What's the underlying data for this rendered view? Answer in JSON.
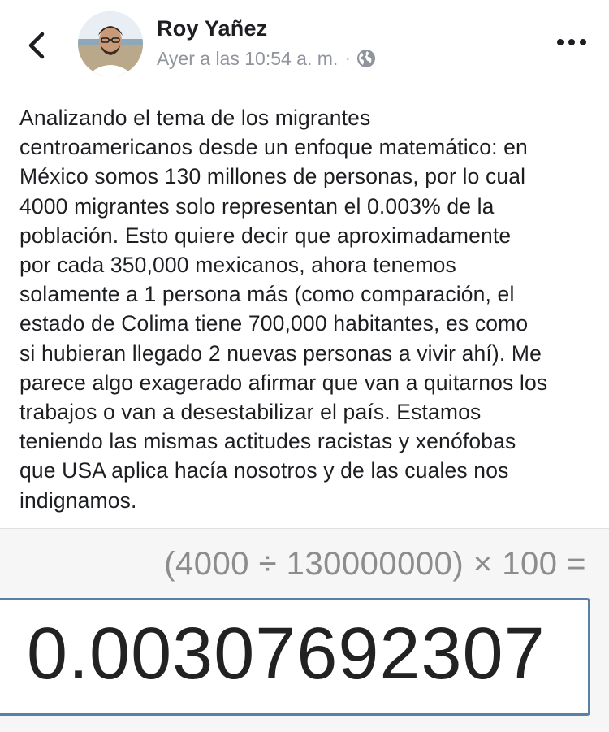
{
  "post": {
    "author_name": "Roy Yañez",
    "timestamp": "Ayer a las 10:54 a. m.",
    "separator": "·",
    "visibility_icon": "globe-icon",
    "text": "Analizando el tema de los migrantes\ncentroamericanos desde un enfoque matemático: en\nMéxico somos 130 millones de personas, por lo cual\n4000 migrantes solo representan el 0.003% de la\npoblación. Esto quiere decir que aproximadamente\npor cada 350,000 mexicanos, ahora tenemos\nsolamente a 1 persona más (como comparación, el\nestado de Colima tiene 700,000 habitantes, es como\nsi hubieran llegado 2 nuevas personas a vivir ahí). Me\nparece algo exagerado afirmar que van a quitarnos los\ntrabajos o van a desestabilizar el país. Estamos\nteniendo las mismas actitudes racistas y xenófobas\nque USA aplica hacía nosotros y de las cuales nos\nindignamos."
  },
  "calculator": {
    "expression": "(4000 ÷ 130000000) × 100 =",
    "result": "0.00307692307"
  },
  "icons": {
    "back": "chevron-left-icon",
    "more": "more-options-icon"
  },
  "colors": {
    "text_primary": "#1c1e21",
    "text_secondary": "#90949c",
    "result_border": "#5c7fa6",
    "calc_background": "#f6f6f6"
  }
}
